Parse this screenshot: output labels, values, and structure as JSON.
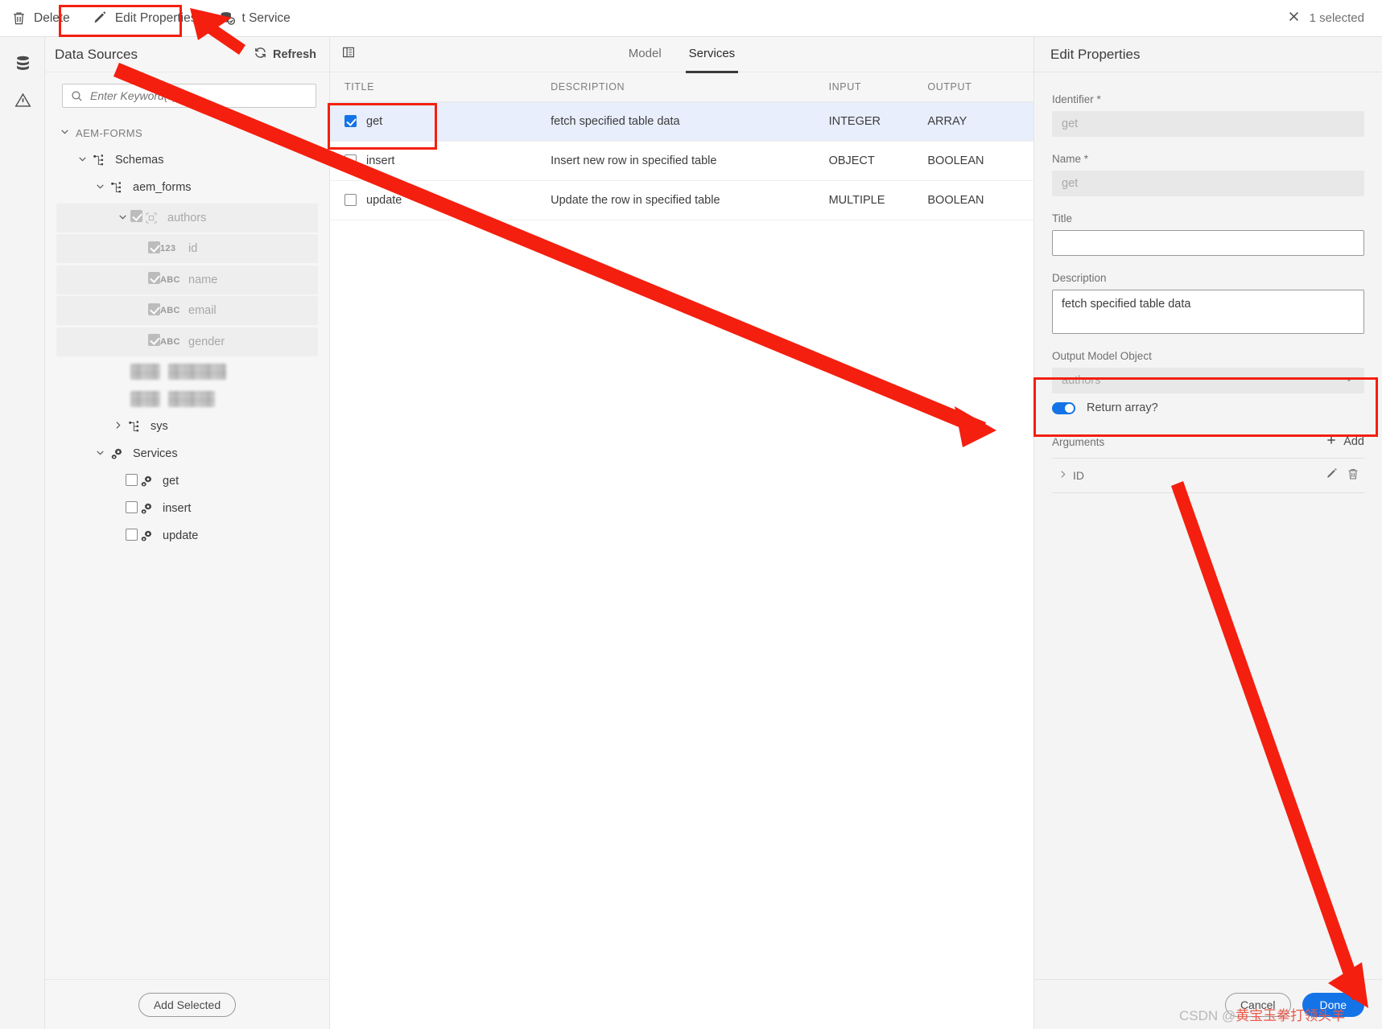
{
  "toolbar": {
    "delete_label": "Delete",
    "edit_properties_label": "Edit Properties",
    "test_service_label": "t Service",
    "selection_count": "1 selected"
  },
  "sidebar": {
    "title": "Data Sources",
    "refresh_label": "Refresh",
    "search": {
      "placeholder": "Enter Keyword(s)",
      "value": ""
    },
    "add_selected_label": "Add Selected",
    "tree": [
      {
        "label": "AEM-FORMS",
        "indent": 0,
        "chevron": "down",
        "kind": "group"
      },
      {
        "label": "Schemas",
        "indent": 1,
        "chevron": "down",
        "kind": "schema-folder"
      },
      {
        "label": "aem_forms",
        "indent": 2,
        "chevron": "down",
        "kind": "schema"
      },
      {
        "label": "authors",
        "indent": 3,
        "chevron": "down",
        "kind": "table",
        "checkbox": "checked-disabled",
        "shaded": true,
        "dim": true
      },
      {
        "label": "id",
        "indent": 4,
        "chevron": "none",
        "kind": "field",
        "type_tag": "123",
        "checkbox": "checked-disabled",
        "shaded": true,
        "dim": true
      },
      {
        "label": "name",
        "indent": 4,
        "chevron": "none",
        "kind": "field",
        "type_tag": "ABC",
        "checkbox": "checked-disabled",
        "shaded": true,
        "dim": true
      },
      {
        "label": "email",
        "indent": 4,
        "chevron": "none",
        "kind": "field",
        "type_tag": "ABC",
        "checkbox": "checked-disabled",
        "shaded": true,
        "dim": true
      },
      {
        "label": "gender",
        "indent": 4,
        "chevron": "none",
        "kind": "field",
        "type_tag": "ABC",
        "checkbox": "checked-disabled",
        "shaded": true,
        "dim": true
      },
      {
        "label": "",
        "indent": 4,
        "kind": "redacted"
      },
      {
        "label": "",
        "indent": 4,
        "kind": "redacted"
      },
      {
        "label": "sys",
        "indent": 3,
        "chevron": "right",
        "kind": "schema"
      },
      {
        "label": "Services",
        "indent": 2,
        "chevron": "down",
        "kind": "services-folder"
      },
      {
        "label": "get",
        "indent": 3,
        "chevron": "none",
        "kind": "service",
        "checkbox": "unchecked"
      },
      {
        "label": "insert",
        "indent": 3,
        "chevron": "none",
        "kind": "service",
        "checkbox": "unchecked"
      },
      {
        "label": "update",
        "indent": 3,
        "chevron": "none",
        "kind": "service",
        "checkbox": "unchecked"
      }
    ]
  },
  "main": {
    "tabs": [
      {
        "label": "Model",
        "active": false
      },
      {
        "label": "Services",
        "active": true
      }
    ],
    "columns": [
      "TITLE",
      "DESCRIPTION",
      "INPUT",
      "OUTPUT"
    ],
    "rows": [
      {
        "title": "get",
        "description": "fetch specified table data",
        "input": "INTEGER",
        "output": "ARRAY",
        "checked": true,
        "selected": true
      },
      {
        "title": "insert",
        "description": "Insert new row in specified table",
        "input": "OBJECT",
        "output": "BOOLEAN",
        "checked": false,
        "selected": false
      },
      {
        "title": "update",
        "description": "Update the row in specified table",
        "input": "MULTIPLE",
        "output": "BOOLEAN",
        "checked": false,
        "selected": false
      }
    ]
  },
  "properties": {
    "panel_title": "Edit Properties",
    "identifier_label": "Identifier *",
    "identifier_value": "get",
    "name_label": "Name *",
    "name_value": "get",
    "title_label": "Title",
    "title_value": "",
    "description_label": "Description",
    "description_value": "fetch specified table data",
    "output_model_label": "Output Model Object",
    "output_model_value": "authors",
    "return_array_label": "Return array?",
    "return_array_on": true,
    "arguments_label": "Arguments",
    "add_label": "Add",
    "arguments": [
      {
        "name": "ID"
      }
    ],
    "cancel_label": "Cancel",
    "done_label": "Done"
  },
  "icons": {
    "delete": "trash-icon",
    "edit": "pencil-icon",
    "test_service": "database-check-icon",
    "close": "close-icon",
    "refresh": "refresh-icon",
    "search": "search-icon",
    "rail_data": "database-icon",
    "rail_alert": "warning-triangle-icon",
    "panel": "panel-icon",
    "add": "plus-icon",
    "chevron_down": "chevron-down-icon",
    "chevron_right": "chevron-right-icon"
  },
  "colors": {
    "accent": "#1473e6",
    "annotation": "#f41f0f",
    "row_selected": "#e8eefb"
  },
  "watermark": {
    "prefix": "CSDN @",
    "text": "黄宝玉拳打领头羊"
  }
}
